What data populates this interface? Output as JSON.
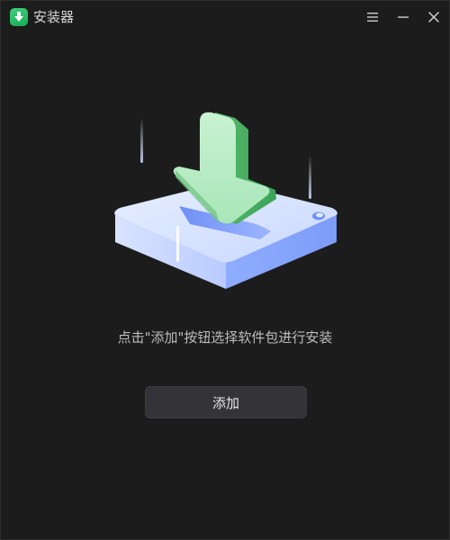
{
  "window": {
    "title": "安装器",
    "app_icon": "download-app-icon",
    "controls": {
      "menu_icon": "hamburger-menu-icon",
      "minimize_icon": "minimize-icon",
      "close_icon": "close-icon"
    }
  },
  "main": {
    "illustration": "install-package-illustration",
    "hint_text": "点击\"添加\"按钮选择软件包进行安装",
    "add_button_label": "添加"
  },
  "colors": {
    "background": "#1c1c1c",
    "accent_green": "#3fd27a",
    "button_bg": "#343438"
  }
}
